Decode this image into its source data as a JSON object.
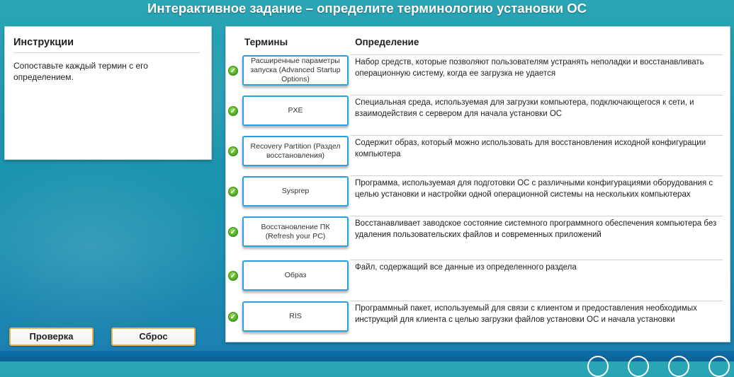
{
  "title": "Интерактивное задание – определите терминологию установки ОС",
  "instructions": {
    "heading": "Инструкции",
    "text": "Сопоставьте каждый термин с его определением."
  },
  "buttons": {
    "check": "Проверка",
    "reset": "Сброс"
  },
  "table": {
    "header_terms": "Термины",
    "header_definition": "Определение",
    "rows": [
      {
        "term": "Расширенные параметры запуска (Advanced Startup Options)",
        "definition": "Набор средств, которые позволяют пользователям устранять неполадки и восстанавливать операционную систему, когда ее загрузка не удается",
        "status": "correct"
      },
      {
        "term": "PXE",
        "definition": "Специальная среда, используемая для загрузки компьютера, подключающегося к сети, и взаимодействия с сервером для начала установки ОС",
        "status": "correct"
      },
      {
        "term": "Recovery Partition (Раздел восстановления)",
        "definition": "Содержит образ, который можно использовать для восстановления исходной конфигурации компьютера",
        "status": "correct"
      },
      {
        "term": "Sysprep",
        "definition": "Программа, используемая для подготовки ОС с различными конфигурациями оборудования с целью установки и настройки одной операционной системы на нескольких компьютерах",
        "status": "correct"
      },
      {
        "term": "Восстановление ПК (Refresh your PC)",
        "definition": "Восстанавливает заводское состояние системного программного обеспечения компьютера без удаления пользовательских файлов и современных приложений",
        "status": "correct"
      },
      {
        "term": "Образ",
        "definition": "Файл, содержащий все данные из определенного раздела",
        "status": "correct"
      },
      {
        "term": "RIS",
        "definition": "Программный пакет, используемый для связи с клиентом и предоставления необходимых инструкций для клиента с целью загрузки файлов установки ОС и начала установки",
        "status": "correct"
      }
    ]
  },
  "icons": {
    "status": "check-icon"
  },
  "colors": {
    "accent": "#2aa0de",
    "button_border": "#e8b44a",
    "check": "#4aa51f"
  }
}
